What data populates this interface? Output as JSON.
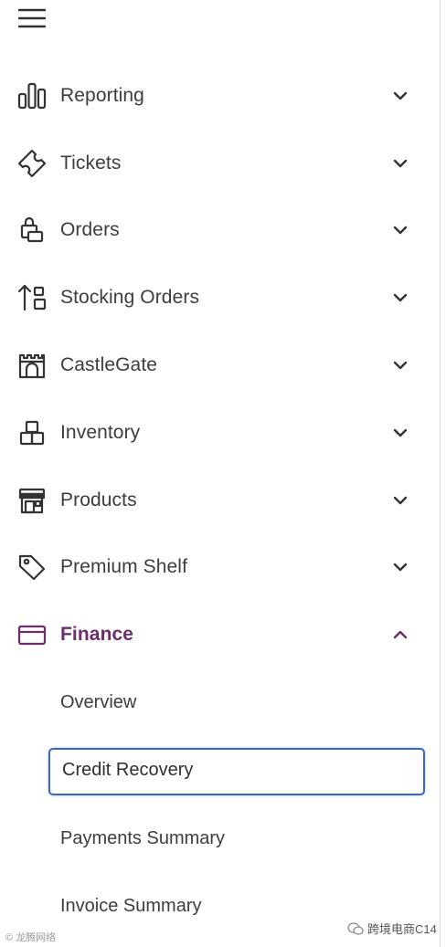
{
  "nav": {
    "items": [
      {
        "label": "Reporting",
        "icon": "bar-chart-icon",
        "expanded": false
      },
      {
        "label": "Tickets",
        "icon": "ticket-icon",
        "expanded": false
      },
      {
        "label": "Orders",
        "icon": "orders-icon",
        "expanded": false
      },
      {
        "label": "Stocking Orders",
        "icon": "stocking-orders-icon",
        "expanded": false
      },
      {
        "label": "CastleGate",
        "icon": "castle-icon",
        "expanded": false
      },
      {
        "label": "Inventory",
        "icon": "boxes-icon",
        "expanded": false
      },
      {
        "label": "Products",
        "icon": "storefront-icon",
        "expanded": false
      },
      {
        "label": "Premium Shelf",
        "icon": "tag-icon",
        "expanded": false
      },
      {
        "label": "Finance",
        "icon": "credit-card-icon",
        "expanded": true
      }
    ],
    "finance_sub": [
      {
        "label": "Overview",
        "selected": false
      },
      {
        "label": "Credit Recovery",
        "selected": true
      },
      {
        "label": "Payments Summary",
        "selected": false
      },
      {
        "label": "Invoice Summary",
        "selected": false
      }
    ]
  },
  "watermark": {
    "left": "© 龙腾网络",
    "right": "跨境电商C14"
  },
  "colors": {
    "active": "#6b2e6b",
    "focus_border": "#3b64c9",
    "text": "#3d3d3d"
  }
}
